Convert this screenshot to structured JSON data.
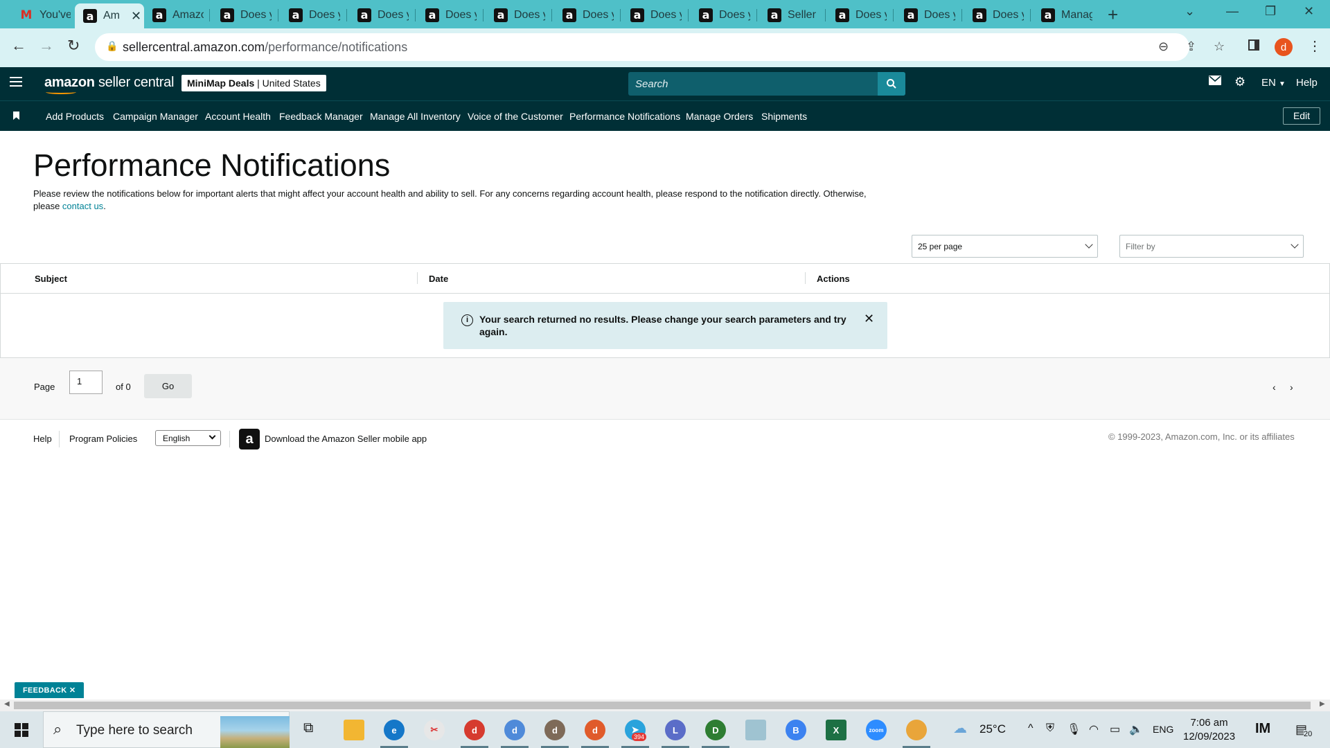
{
  "browser": {
    "tabs": [
      {
        "title": "You've",
        "icon": "gmail-icon"
      },
      {
        "title": "Am",
        "icon": "amazon-icon",
        "active": true
      },
      {
        "title": "Amazo",
        "icon": "amazon-icon"
      },
      {
        "title": "Does y",
        "icon": "amazon-icon"
      },
      {
        "title": "Does y",
        "icon": "amazon-icon"
      },
      {
        "title": "Does y",
        "icon": "amazon-icon"
      },
      {
        "title": "Does y",
        "icon": "amazon-icon"
      },
      {
        "title": "Does y",
        "icon": "amazon-icon"
      },
      {
        "title": "Does y",
        "icon": "amazon-icon"
      },
      {
        "title": "Does y",
        "icon": "amazon-icon"
      },
      {
        "title": "Does y",
        "icon": "amazon-icon"
      },
      {
        "title": "Seller U",
        "icon": "amazon-icon"
      },
      {
        "title": "Does y",
        "icon": "amazon-icon"
      },
      {
        "title": "Does y",
        "icon": "amazon-icon"
      },
      {
        "title": "Does y",
        "icon": "amazon-icon"
      },
      {
        "title": "Manag",
        "icon": "amazon-icon"
      }
    ],
    "url_domain": "sellercentral.amazon.com",
    "url_path": "/performance/notifications",
    "profile_initial": "d",
    "colors": {
      "tabstrip": "#4fc0c8",
      "toolbar": "#d9f2f4"
    }
  },
  "header": {
    "logo_brand": "amazon",
    "logo_product": "seller central",
    "store_name": "MiniMap Deals",
    "store_sep": " | ",
    "store_region": "United States",
    "search_placeholder": "Search",
    "lang": "EN",
    "help": "Help",
    "colors": {
      "bg": "#002f36",
      "search": "#0f5f6c",
      "accent": "#ff9900"
    }
  },
  "nav": {
    "items": [
      "Add Products",
      "Campaign Manager",
      "Account Health",
      "Feedback Manager",
      "Manage All Inventory",
      "Voice of the Customer",
      "Performance Notifications",
      "Manage Orders",
      "Shipments"
    ],
    "edit": "Edit"
  },
  "main": {
    "title": "Performance Notifications",
    "intro": "Please review the notifications below for important alerts that might affect your account health and ability to sell. For any concerns regarding account health, please respond to the notification directly. Otherwise, please ",
    "intro_link": "contact us",
    "intro_end": ".",
    "per_page": "25 per page",
    "filter_placeholder": "Filter by",
    "columns": [
      "Subject",
      "Date",
      "Actions"
    ],
    "alert_message": "Your search returned no results. Please change your search parameters and try again.",
    "alert_bg": "#dcedf0"
  },
  "pagination": {
    "page_label": "Page",
    "page_value": "1",
    "of_label": "of 0",
    "go": "Go"
  },
  "footer": {
    "help": "Help",
    "policies": "Program Policies",
    "language": "English",
    "app_text": "Download the Amazon Seller mobile app",
    "copyright": "© 1999-2023, Amazon.com, Inc. or its affiliates"
  },
  "feedback": "FEEDBACK",
  "taskbar": {
    "search_placeholder": "Type here to search",
    "badge_count": "394",
    "weather": "25°C",
    "lang": "ENG",
    "time": "7:06 am",
    "date": "12/09/2023",
    "notification_count": "20"
  }
}
